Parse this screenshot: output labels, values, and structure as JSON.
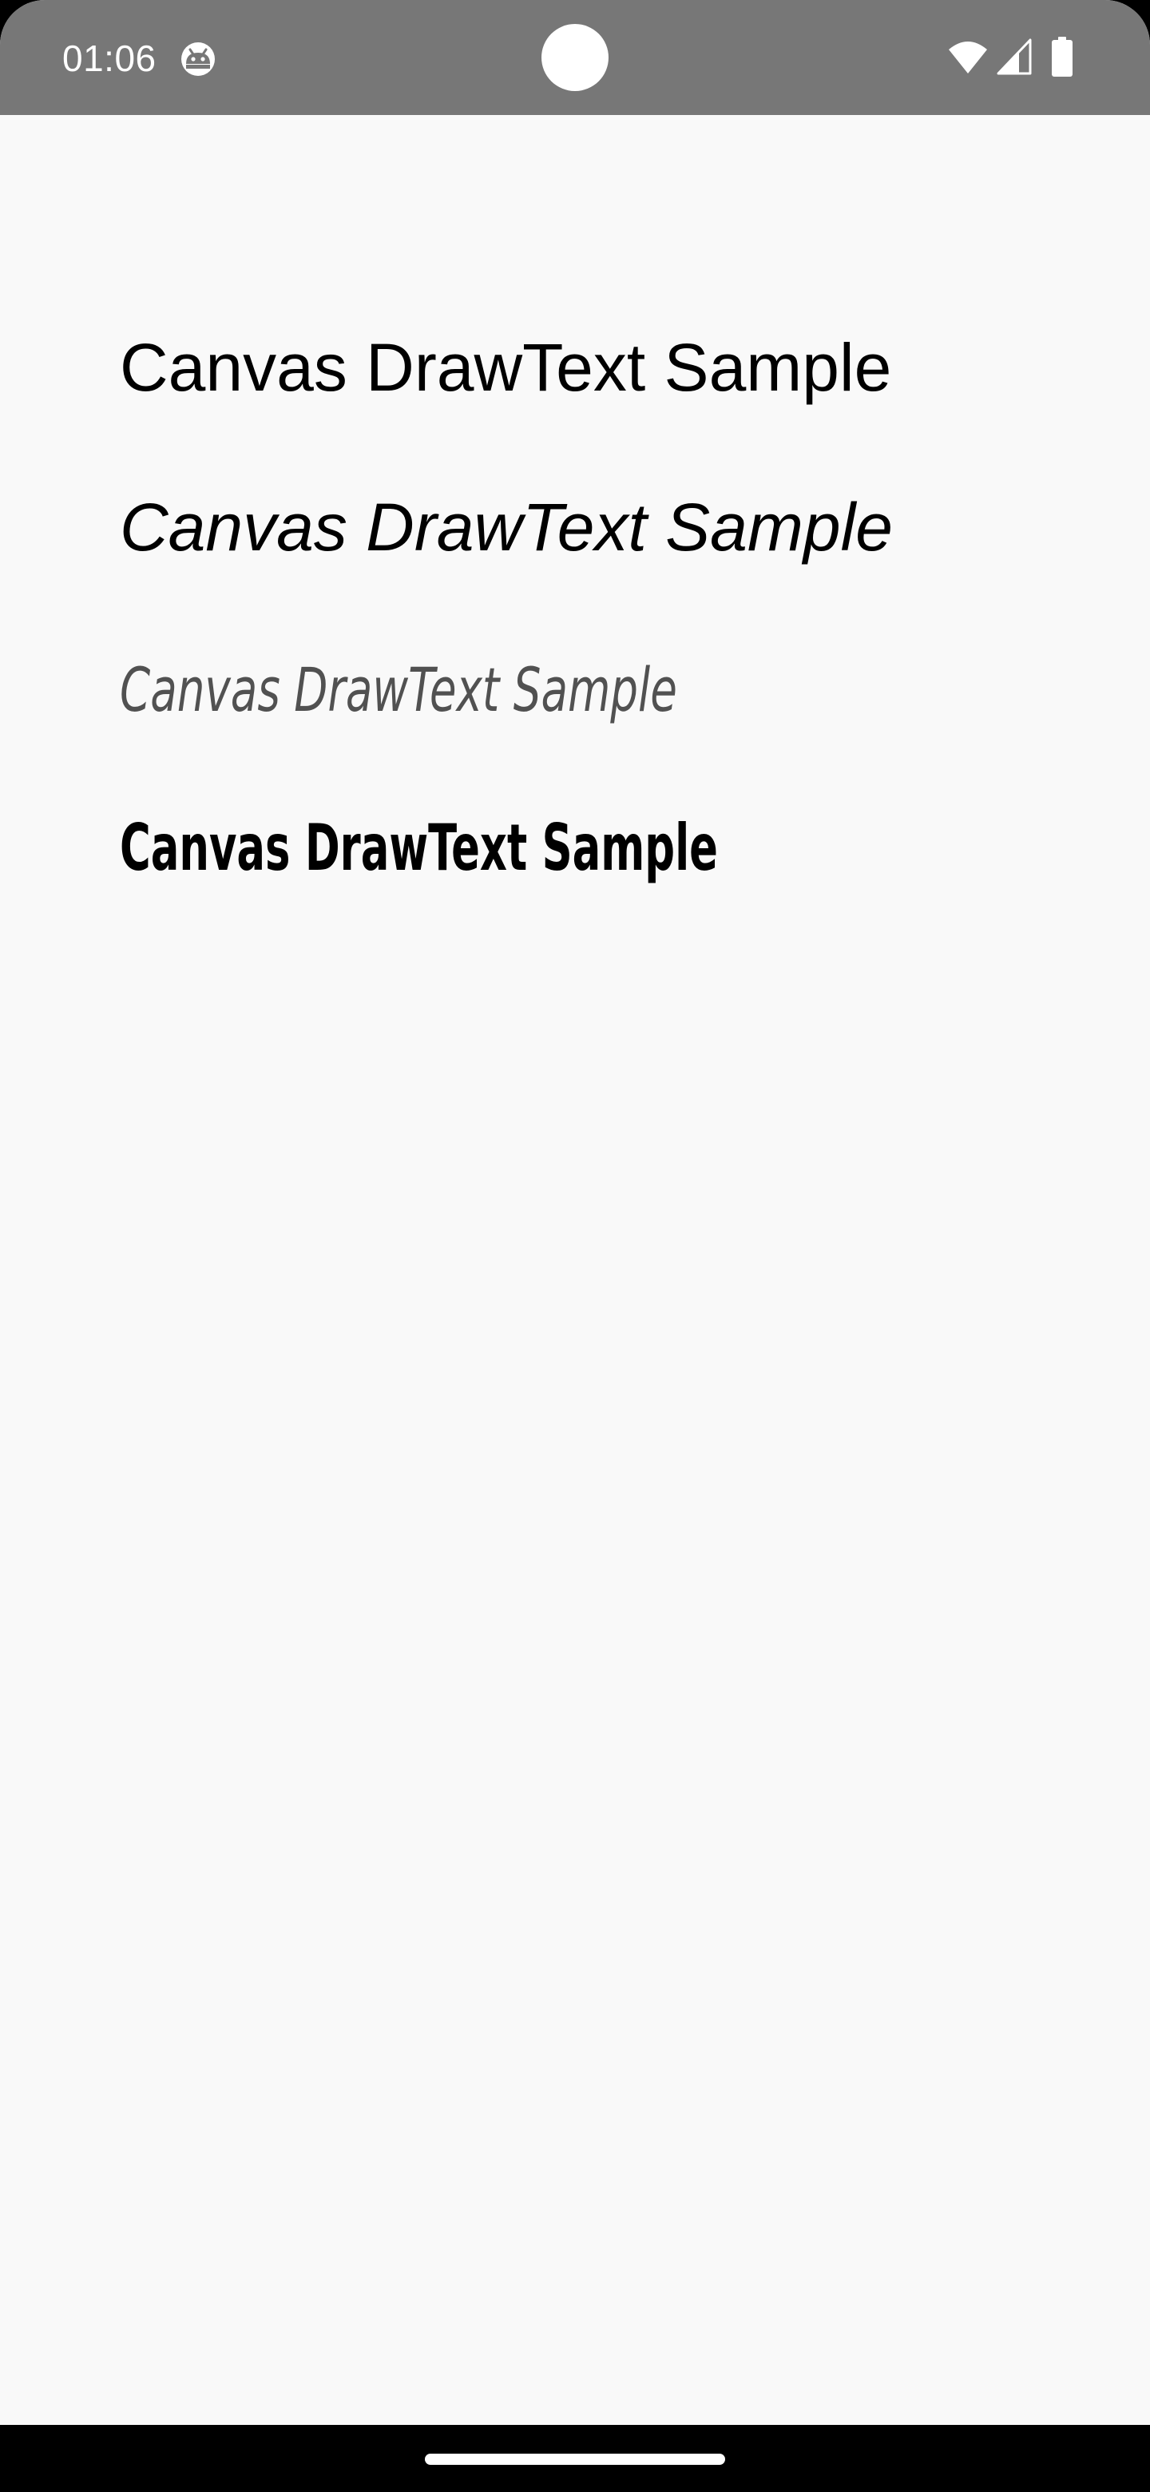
{
  "status_bar": {
    "time": "01:06",
    "app_icon": "android-robot-icon",
    "wifi_icon": "wifi-icon",
    "signal_icon": "cell-signal-icon",
    "battery_icon": "battery-full-icon",
    "background_color": "#777777"
  },
  "canvas": {
    "background_color": "#f9f9f9",
    "samples": [
      {
        "text": "Canvas DrawText Sample",
        "style": "regular"
      },
      {
        "text": "Canvas DrawText Sample",
        "style": "italic"
      },
      {
        "text": "Canvas DrawText Sample",
        "style": "thin-italic-condensed"
      },
      {
        "text": "Canvas DrawText Sample",
        "style": "bold-condensed"
      }
    ]
  },
  "navigation_bar": {
    "handle": "home-gesture-handle"
  }
}
